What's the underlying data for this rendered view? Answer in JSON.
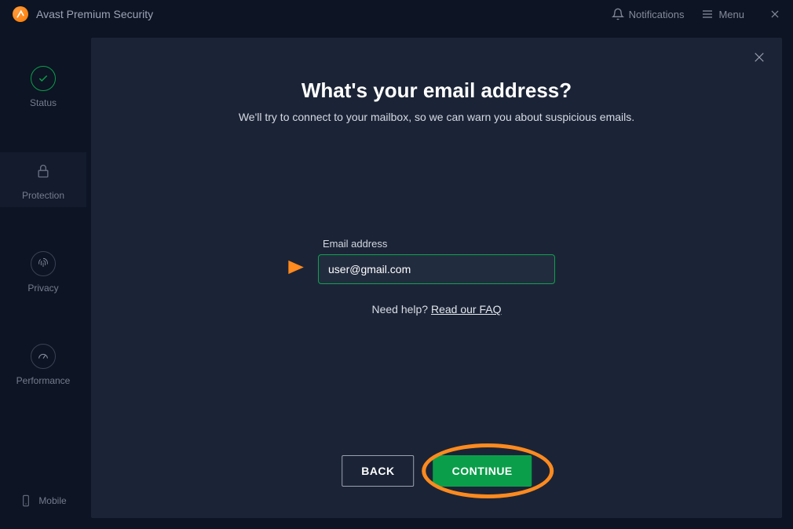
{
  "titlebar": {
    "app_title": "Avast Premium Security",
    "notifications_label": "Notifications",
    "menu_label": "Menu"
  },
  "sidebar": {
    "items": [
      {
        "label": "Status"
      },
      {
        "label": "Protection"
      },
      {
        "label": "Privacy"
      },
      {
        "label": "Performance"
      }
    ],
    "bottom_label": "Mobile"
  },
  "modal": {
    "title": "What's your email address?",
    "subtitle": "We'll try to connect to your mailbox, so we can warn you about suspicious emails.",
    "field_label": "Email address",
    "email_value": "user@gmail.com",
    "help_text": "Need help? ",
    "help_link": "Read our FAQ",
    "back_label": "BACK",
    "continue_label": "CONTINUE"
  }
}
